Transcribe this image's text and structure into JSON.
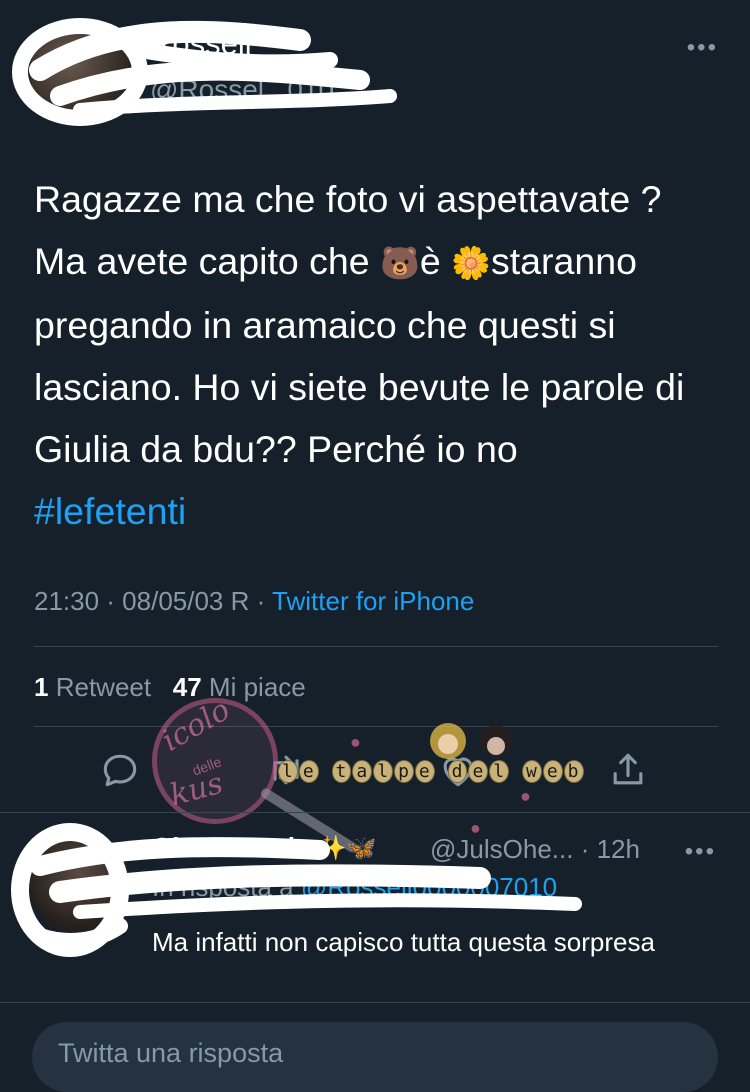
{
  "tweet": {
    "display_name": "Rossell",
    "handle": "@Rossel...010",
    "text_lines": [
      "Ragazze ma che foto vi aspettavate ?",
      "Ma avete capito che",
      "è",
      "staranno",
      "pregando in aramaico che questi si",
      "lasciano. Ho vi siete bevute le parole di",
      "Giulia da bdu?? Perché io no"
    ],
    "emoji_bear": "🐻",
    "emoji_flower": "🌼",
    "hashtag": "#lefetenti",
    "time": "21:30 · 08/05/03 R ·",
    "source": "Twitter for iPhone",
    "retweets_count": "1",
    "retweets_label": "Retweet",
    "likes_count": "47",
    "likes_label": "Mi piace",
    "more": "•••"
  },
  "actions": [
    {
      "name": "reply-icon"
    },
    {
      "name": "retweet-icon"
    },
    {
      "name": "like-icon"
    },
    {
      "name": "share-icon"
    }
  ],
  "watermark": {
    "line1": "icolo",
    "line2": "delle",
    "line3": "kus",
    "brand": "le talpe del web"
  },
  "reply": {
    "display_name": "OhoomaJuls",
    "emojis": "✨🦋",
    "handle": "@JulsOhe...",
    "age": "· 12h",
    "more": "•••",
    "reply_to_prefix": "In risposta a",
    "reply_to_handle": "@Rossell0000007010",
    "text": "Ma infatti non capisco tutta questa sorpresa"
  },
  "composer": {
    "placeholder": "Twitta una risposta"
  },
  "colors": {
    "background": "#15202b",
    "accent": "#1da1f2",
    "muted": "#8899a6",
    "divider": "#38444d"
  }
}
